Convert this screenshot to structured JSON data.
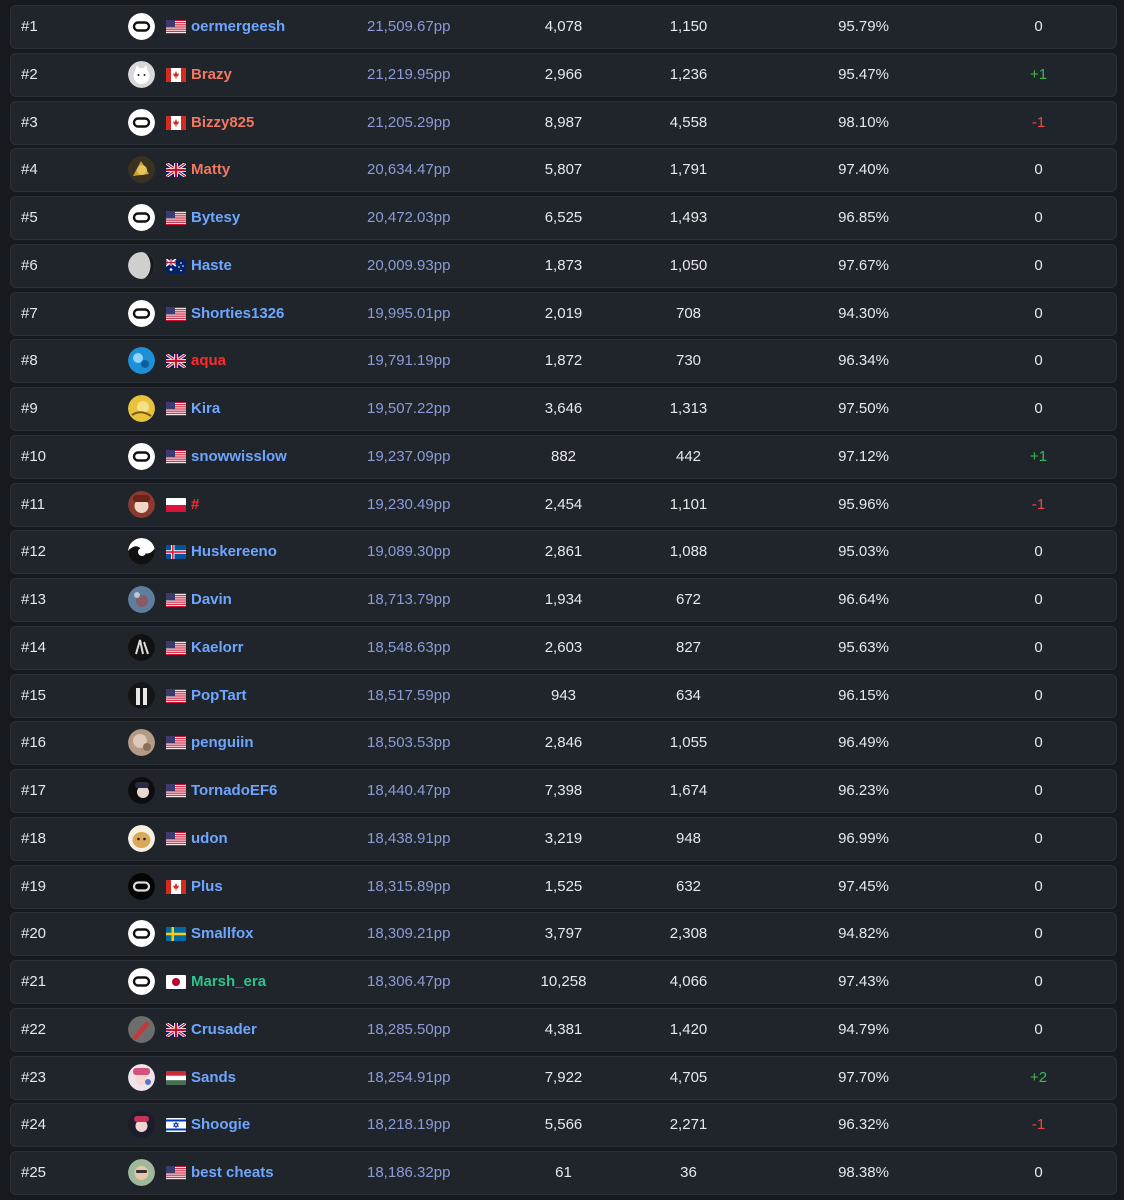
{
  "leaderboard": {
    "rows": [
      {
        "rank": "#1",
        "avatar": "oculus",
        "flag": "us",
        "name": "oermergeesh",
        "name_color": "#6ea6ff",
        "pp": "21,509.67pp",
        "plays": "4,078",
        "top_plays": "1,150",
        "accuracy": "95.79%",
        "change": "0"
      },
      {
        "rank": "#2",
        "avatar": "cat",
        "flag": "ca",
        "name": "Brazy",
        "name_color": "#f07860",
        "pp": "21,219.95pp",
        "plays": "2,966",
        "top_plays": "1,236",
        "accuracy": "95.47%",
        "change": "+1"
      },
      {
        "rank": "#3",
        "avatar": "oculus",
        "flag": "ca",
        "name": "Bizzy825",
        "name_color": "#f07860",
        "pp": "21,205.29pp",
        "plays": "8,987",
        "top_plays": "4,558",
        "accuracy": "98.10%",
        "change": "-1"
      },
      {
        "rank": "#4",
        "avatar": "gold",
        "flag": "gb",
        "name": "Matty",
        "name_color": "#f07860",
        "pp": "20,634.47pp",
        "plays": "5,807",
        "top_plays": "1,791",
        "accuracy": "97.40%",
        "change": "0"
      },
      {
        "rank": "#5",
        "avatar": "oculus",
        "flag": "us",
        "name": "Bytesy",
        "name_color": "#6ea6ff",
        "pp": "20,472.03pp",
        "plays": "6,525",
        "top_plays": "1,493",
        "accuracy": "96.85%",
        "change": "0"
      },
      {
        "rank": "#6",
        "avatar": "moon",
        "flag": "au",
        "name": "Haste",
        "name_color": "#6ea6ff",
        "pp": "20,009.93pp",
        "plays": "1,873",
        "top_plays": "1,050",
        "accuracy": "97.67%",
        "change": "0"
      },
      {
        "rank": "#7",
        "avatar": "oculus",
        "flag": "us",
        "name": "Shorties1326",
        "name_color": "#6ea6ff",
        "pp": "19,995.01pp",
        "plays": "2,019",
        "top_plays": "708",
        "accuracy": "94.30%",
        "change": "0"
      },
      {
        "rank": "#8",
        "avatar": "water",
        "flag": "gb",
        "name": "aqua",
        "name_color": "#ff2b2b",
        "pp": "19,791.19pp",
        "plays": "1,872",
        "top_plays": "730",
        "accuracy": "96.34%",
        "change": "0"
      },
      {
        "rank": "#9",
        "avatar": "yellow",
        "flag": "us",
        "name": "Kira",
        "name_color": "#6ea6ff",
        "pp": "19,507.22pp",
        "plays": "3,646",
        "top_plays": "1,313",
        "accuracy": "97.50%",
        "change": "0"
      },
      {
        "rank": "#10",
        "avatar": "oculus",
        "flag": "us",
        "name": "snowwisslow",
        "name_color": "#6ea6ff",
        "pp": "19,237.09pp",
        "plays": "882",
        "top_plays": "442",
        "accuracy": "97.12%",
        "change": "+1"
      },
      {
        "rank": "#11",
        "avatar": "anime-red",
        "flag": "pl",
        "name": "#",
        "name_color": "#ff2b2b",
        "pp": "19,230.49pp",
        "plays": "2,454",
        "top_plays": "1,101",
        "accuracy": "95.96%",
        "change": "-1"
      },
      {
        "rank": "#12",
        "avatar": "bw",
        "flag": "is",
        "name": "Huskereeno",
        "name_color": "#6ea6ff",
        "pp": "19,089.30pp",
        "plays": "2,861",
        "top_plays": "1,088",
        "accuracy": "95.03%",
        "change": "0"
      },
      {
        "rank": "#13",
        "avatar": "blue-grey",
        "flag": "us",
        "name": "Davin",
        "name_color": "#6ea6ff",
        "pp": "18,713.79pp",
        "plays": "1,934",
        "top_plays": "672",
        "accuracy": "96.64%",
        "change": "0"
      },
      {
        "rank": "#14",
        "avatar": "dark",
        "flag": "us",
        "name": "Kaelorr",
        "name_color": "#6ea6ff",
        "pp": "18,548.63pp",
        "plays": "2,603",
        "top_plays": "827",
        "accuracy": "95.63%",
        "change": "0"
      },
      {
        "rank": "#15",
        "avatar": "dark-figures",
        "flag": "us",
        "name": "PopTart",
        "name_color": "#6ea6ff",
        "pp": "18,517.59pp",
        "plays": "943",
        "top_plays": "634",
        "accuracy": "96.15%",
        "change": "0"
      },
      {
        "rank": "#16",
        "avatar": "beige",
        "flag": "us",
        "name": "penguiin",
        "name_color": "#6ea6ff",
        "pp": "18,503.53pp",
        "plays": "2,846",
        "top_plays": "1,055",
        "accuracy": "96.49%",
        "change": "0"
      },
      {
        "rank": "#17",
        "avatar": "anime-dark",
        "flag": "us",
        "name": "TornadoEF6",
        "name_color": "#6ea6ff",
        "pp": "18,440.47pp",
        "plays": "7,398",
        "top_plays": "1,674",
        "accuracy": "96.23%",
        "change": "0"
      },
      {
        "rank": "#18",
        "avatar": "tan",
        "flag": "us",
        "name": "udon",
        "name_color": "#6ea6ff",
        "pp": "18,438.91pp",
        "plays": "3,219",
        "top_plays": "948",
        "accuracy": "96.99%",
        "change": "0"
      },
      {
        "rank": "#19",
        "avatar": "oculus-dark",
        "flag": "ca",
        "name": "Plus",
        "name_color": "#6ea6ff",
        "pp": "18,315.89pp",
        "plays": "1,525",
        "top_plays": "632",
        "accuracy": "97.45%",
        "change": "0"
      },
      {
        "rank": "#20",
        "avatar": "oculus",
        "flag": "se",
        "name": "Smallfox",
        "name_color": "#6ea6ff",
        "pp": "18,309.21pp",
        "plays": "3,797",
        "top_plays": "2,308",
        "accuracy": "94.82%",
        "change": "0"
      },
      {
        "rank": "#21",
        "avatar": "oculus",
        "flag": "jp",
        "name": "Marsh_era",
        "name_color": "#2ec28a",
        "pp": "18,306.47pp",
        "plays": "10,258",
        "top_plays": "4,066",
        "accuracy": "97.43%",
        "change": "0"
      },
      {
        "rank": "#22",
        "avatar": "red-grey",
        "flag": "gb",
        "name": "Crusader",
        "name_color": "#6ea6ff",
        "pp": "18,285.50pp",
        "plays": "4,381",
        "top_plays": "1,420",
        "accuracy": "94.79%",
        "change": "0"
      },
      {
        "rank": "#23",
        "avatar": "anime-pink",
        "flag": "hu",
        "name": "Sands",
        "name_color": "#6ea6ff",
        "pp": "18,254.91pp",
        "plays": "7,922",
        "top_plays": "4,705",
        "accuracy": "97.70%",
        "change": "+2"
      },
      {
        "rank": "#24",
        "avatar": "anime-blue",
        "flag": "il",
        "name": "Shoogie",
        "name_color": "#6ea6ff",
        "pp": "18,218.19pp",
        "plays": "5,566",
        "top_plays": "2,271",
        "accuracy": "96.32%",
        "change": "-1"
      },
      {
        "rank": "#25",
        "avatar": "face",
        "flag": "us",
        "name": "best cheats",
        "name_color": "#6ea6ff",
        "pp": "18,186.32pp",
        "plays": "61",
        "top_plays": "36",
        "accuracy": "98.38%",
        "change": "0"
      }
    ]
  },
  "colors": {
    "change_up": "#3fb950",
    "change_down": "#f0473c",
    "change_neutral": "#e6e8eb"
  }
}
